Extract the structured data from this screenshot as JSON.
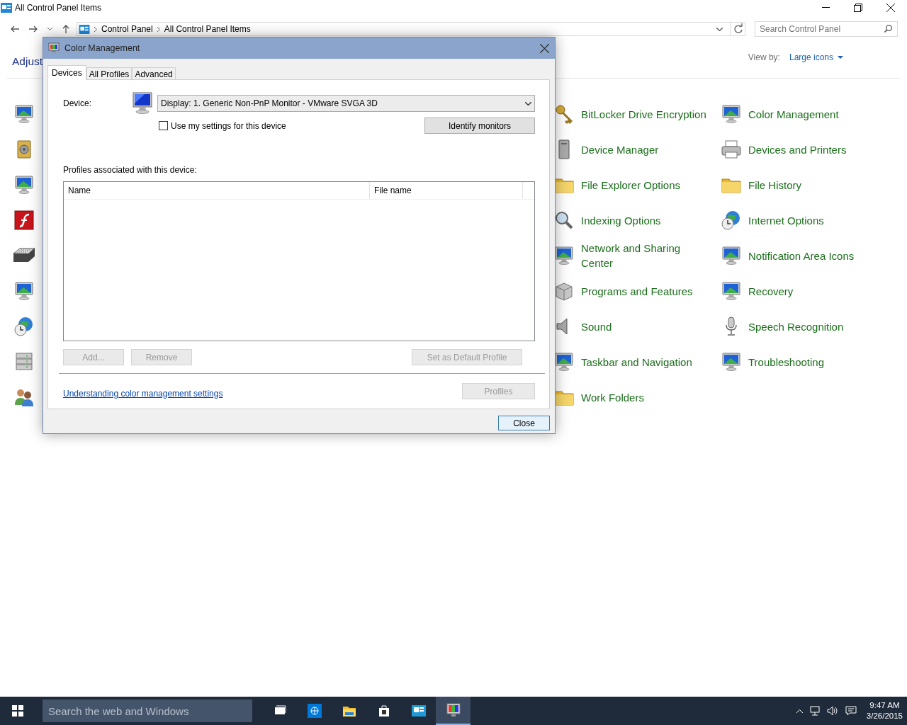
{
  "window": {
    "title": "All Control Panel Items"
  },
  "address": {
    "crumbs": [
      "Control Panel",
      "All Control Panel Items"
    ]
  },
  "search": {
    "placeholder": "Search Control Panel"
  },
  "heading": "Adjust",
  "view_by": {
    "label": "View by:",
    "value": "Large icons"
  },
  "covered_items": [
    {
      "kind": "monitor"
    },
    {
      "kind": "safe"
    },
    {
      "kind": "monitor"
    },
    {
      "kind": "app"
    },
    {
      "kind": "keyboard"
    },
    {
      "kind": "monitor"
    },
    {
      "kind": "globe"
    },
    {
      "kind": "server"
    },
    {
      "kind": "people"
    }
  ],
  "items_column_2": [
    {
      "label": "BitLocker Drive Encryption",
      "kind": "key"
    },
    {
      "label": "Device Manager",
      "kind": "tower"
    },
    {
      "label": "File Explorer Options",
      "kind": "folder"
    },
    {
      "label": "Indexing Options",
      "kind": "magnifier"
    },
    {
      "label": "Network and Sharing Center",
      "kind": "monitor"
    },
    {
      "label": "Programs and Features",
      "kind": "box"
    },
    {
      "label": "Sound",
      "kind": "speaker"
    },
    {
      "label": "Taskbar and Navigation",
      "kind": "monitor"
    },
    {
      "label": "Work Folders",
      "kind": "folder"
    }
  ],
  "items_column_3": [
    {
      "label": "Color Management",
      "kind": "monitor"
    },
    {
      "label": "Devices and Printers",
      "kind": "printer"
    },
    {
      "label": "File History",
      "kind": "folder"
    },
    {
      "label": "Internet Options",
      "kind": "globe"
    },
    {
      "label": "Notification Area Icons",
      "kind": "monitor"
    },
    {
      "label": "Recovery",
      "kind": "monitor"
    },
    {
      "label": "Speech Recognition",
      "kind": "mic"
    },
    {
      "label": "Troubleshooting",
      "kind": "monitor"
    }
  ],
  "dialog": {
    "title": "Color Management",
    "tabs": [
      {
        "label": "Devices",
        "selected": true
      },
      {
        "label": "All Profiles",
        "selected": false
      },
      {
        "label": "Advanced",
        "selected": false
      }
    ],
    "device_label": "Device:",
    "device": "Display: 1. Generic Non-PnP Monitor - VMware SVGA 3D",
    "use_my_settings": {
      "label": "Use my settings for this device",
      "checked": false
    },
    "identify_button": "Identify monitors",
    "profiles_label": "Profiles associated with this device:",
    "columns": [
      "Name",
      "File name"
    ],
    "buttons": [
      {
        "label": "Add...",
        "disabled": true
      },
      {
        "label": "Remove",
        "disabled": true
      },
      {
        "label": "Set as Default Profile",
        "disabled": true
      }
    ],
    "link": "Understanding color management settings",
    "profiles_button": {
      "label": "Profiles",
      "disabled": true
    },
    "close_button": "Close"
  },
  "taskbar": {
    "search_placeholder": "Search the web and Windows",
    "apps": [
      {
        "kind": "taskview",
        "active": false
      },
      {
        "kind": "browser",
        "active": false
      },
      {
        "kind": "folder",
        "active": false
      },
      {
        "kind": "store",
        "active": false
      },
      {
        "kind": "panel",
        "active": false
      },
      {
        "kind": "monitor",
        "active": true
      }
    ],
    "time": "9:47 AM",
    "date": "3/26/2015"
  }
}
